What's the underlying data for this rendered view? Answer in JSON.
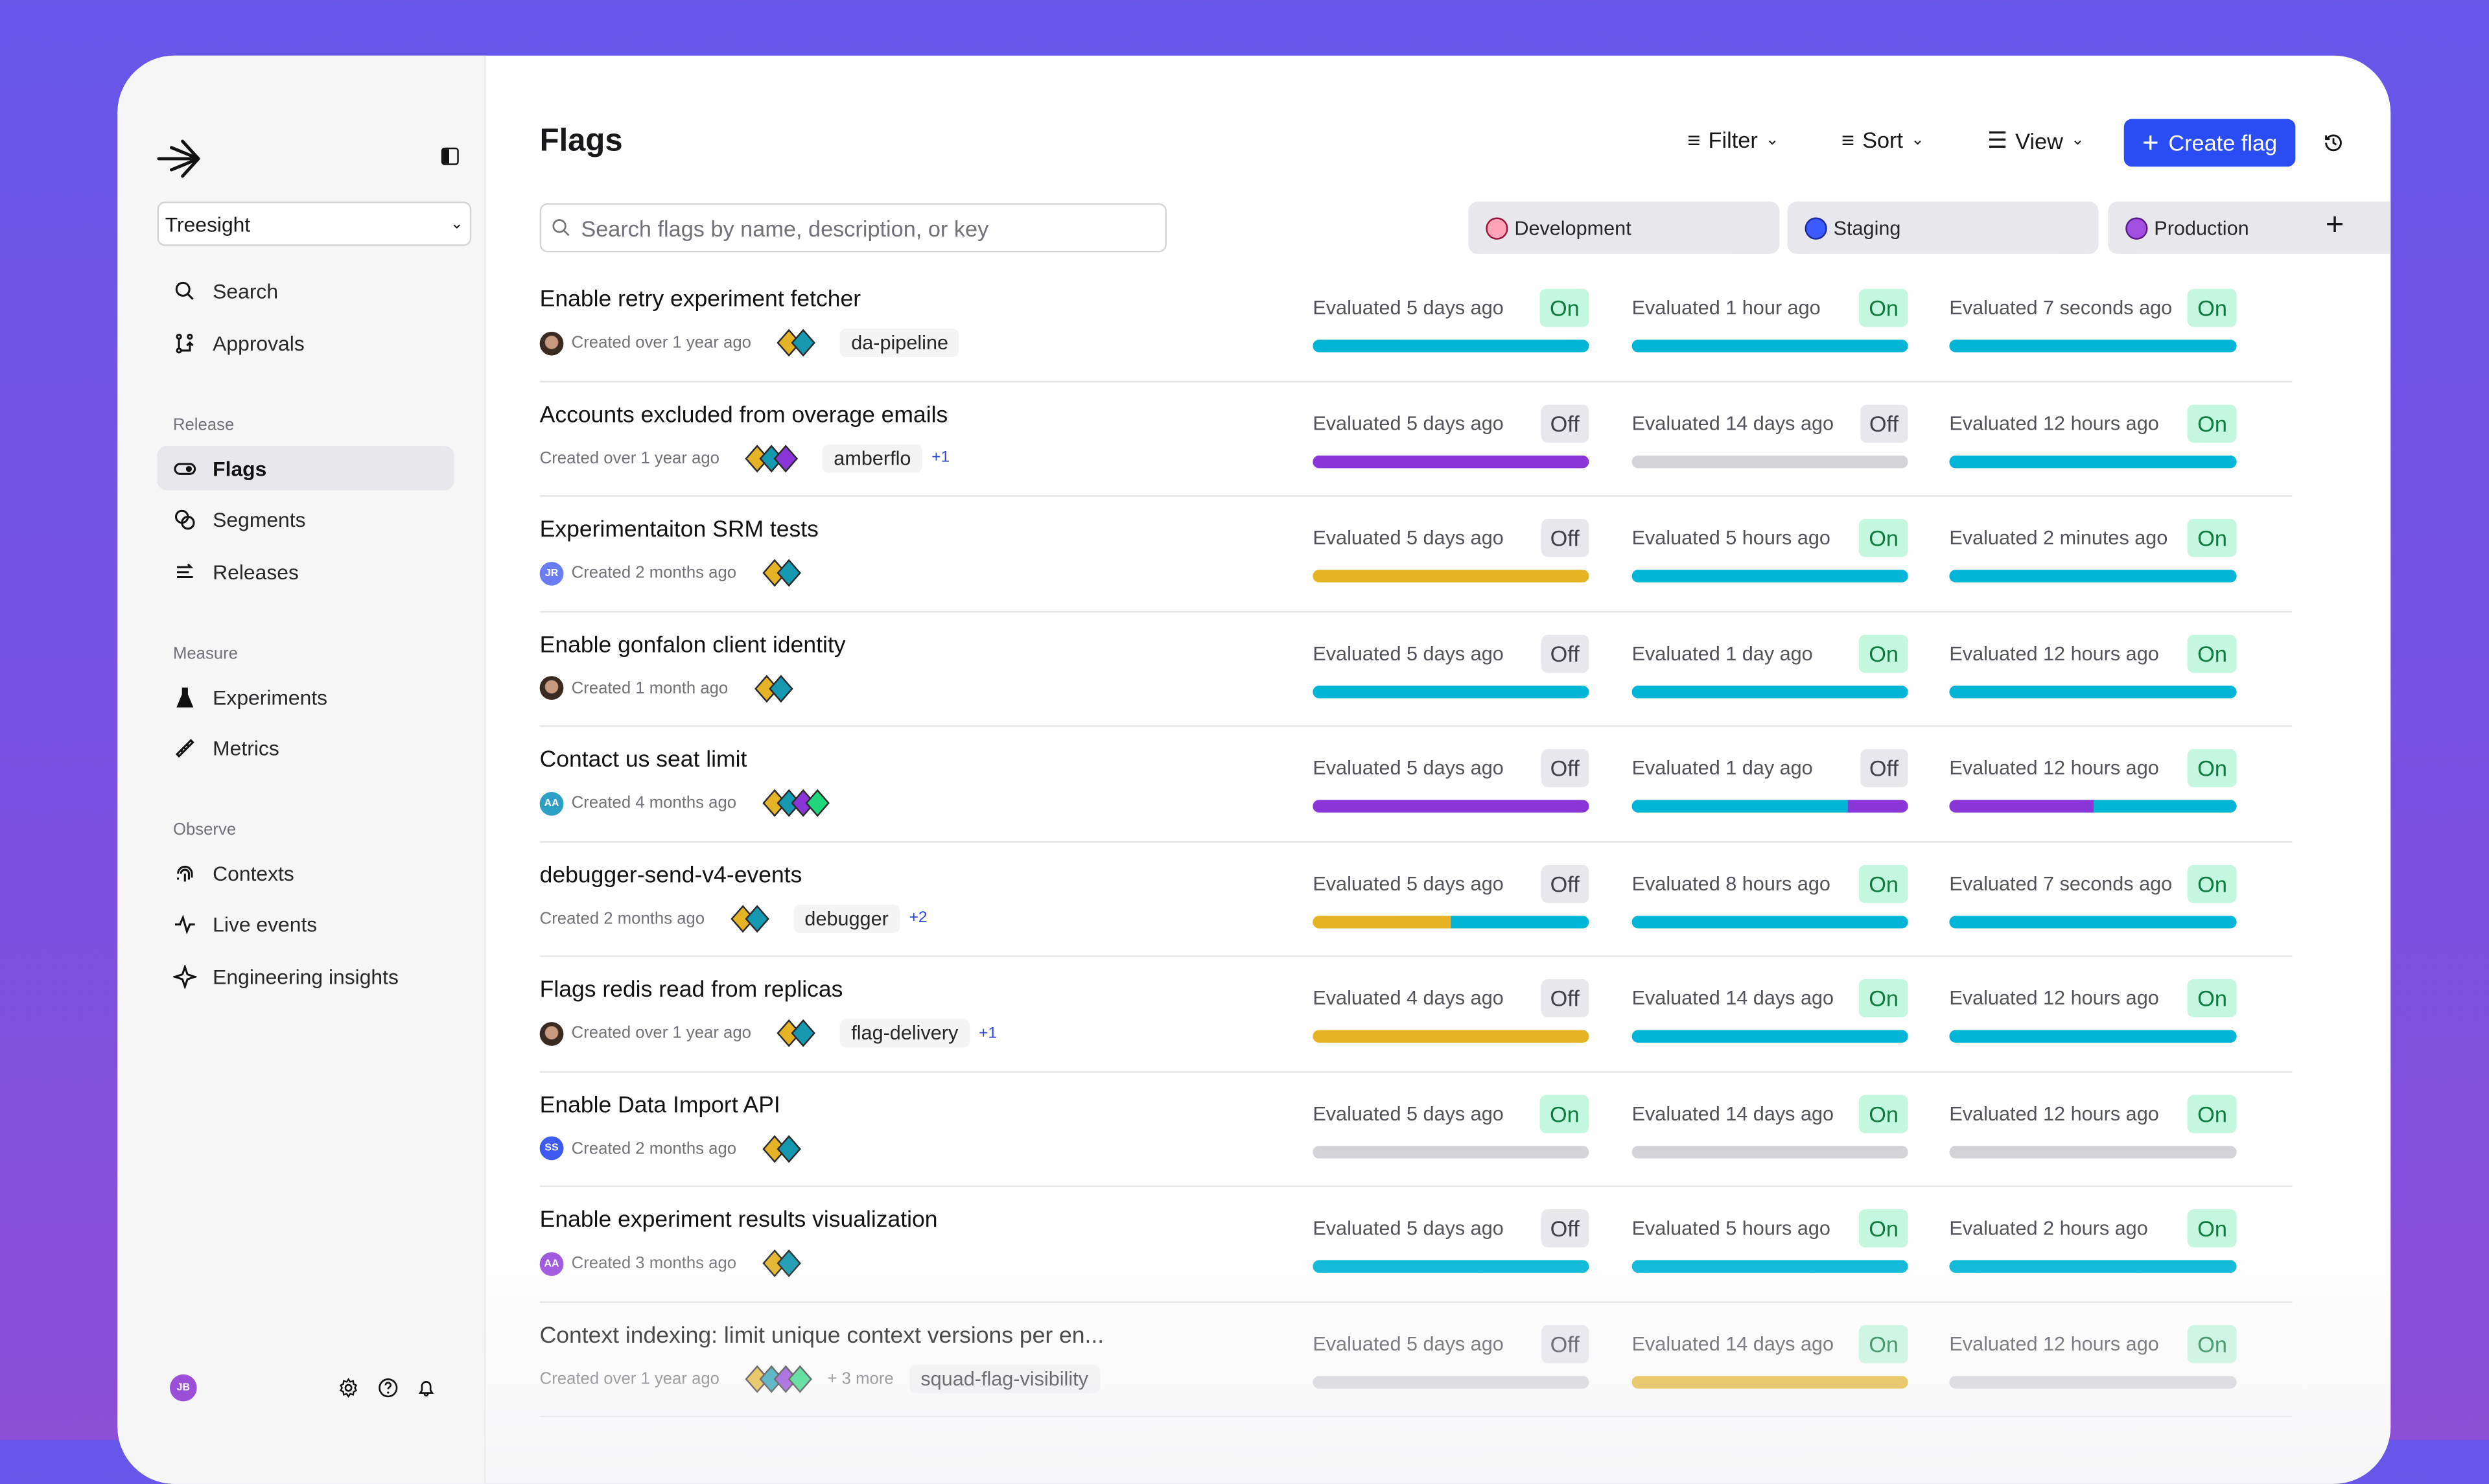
{
  "sidebar": {
    "project": "Treesight",
    "top_items": [
      {
        "label": "Search",
        "icon": "search-icon"
      },
      {
        "label": "Approvals",
        "icon": "approvals-icon"
      }
    ],
    "sections": [
      {
        "label": "Release",
        "items": [
          {
            "label": "Flags",
            "icon": "toggle-icon",
            "active": true
          },
          {
            "label": "Segments",
            "icon": "segments-icon"
          },
          {
            "label": "Releases",
            "icon": "releases-icon"
          }
        ]
      },
      {
        "label": "Measure",
        "items": [
          {
            "label": "Experiments",
            "icon": "flask-icon"
          },
          {
            "label": "Metrics",
            "icon": "ruler-icon"
          }
        ]
      },
      {
        "label": "Observe",
        "items": [
          {
            "label": "Contexts",
            "icon": "fingerprint-icon"
          },
          {
            "label": "Live events",
            "icon": "pulse-icon"
          },
          {
            "label": "Engineering insights",
            "icon": "sparkle-icon"
          }
        ]
      }
    ],
    "user_initials": "JB"
  },
  "header": {
    "title": "Flags",
    "filter": "Filter",
    "sort": "Sort",
    "view": "View",
    "create": "Create flag"
  },
  "search": {
    "placeholder": "Search flags by name, description, or key"
  },
  "environments": [
    {
      "name": "Development",
      "color": "#fda4b8",
      "border": "#9f1239"
    },
    {
      "name": "Staging",
      "color": "#3b5bff",
      "border": "#1e2a9a"
    },
    {
      "name": "Production",
      "color": "#a24ee0",
      "border": "#5b1a8a"
    }
  ],
  "colors": {
    "cyan": "#00b5d6",
    "purple": "#8a35d8",
    "yellow": "#e5b324",
    "gray": "#d4d4d8",
    "teal": "#1599b0",
    "green": "#1fd67a",
    "accent": "#2a4cf5"
  },
  "flags": [
    {
      "name": "Enable retry experiment fetcher",
      "avatar": {
        "type": "photo"
      },
      "created": "Created over 1 year ago",
      "diamonds": [
        "yellow",
        "teal"
      ],
      "tag": "da-pipeline",
      "envs": [
        {
          "eval": "Evaluated 5 days ago",
          "state": "On",
          "bar": [
            [
              "cyan",
              100
            ]
          ]
        },
        {
          "eval": "Evaluated 1 hour ago",
          "state": "On",
          "bar": [
            [
              "cyan",
              100
            ]
          ]
        },
        {
          "eval": "Evaluated 7 seconds ago",
          "state": "On",
          "bar": [
            [
              "cyan",
              100
            ]
          ]
        }
      ]
    },
    {
      "name": "Accounts excluded from overage emails",
      "avatar": {
        "type": "none"
      },
      "created": "Created over 1 year ago",
      "diamonds": [
        "yellow",
        "teal",
        "purple"
      ],
      "tag": "amberflo",
      "extra": "+1",
      "envs": [
        {
          "eval": "Evaluated 5 days ago",
          "state": "Off",
          "bar": [
            [
              "purple",
              100
            ]
          ]
        },
        {
          "eval": "Evaluated 14 days ago",
          "state": "Off",
          "bar": [
            [
              "gray",
              100
            ]
          ]
        },
        {
          "eval": "Evaluated 12 hours ago",
          "state": "On",
          "bar": [
            [
              "cyan",
              100
            ]
          ]
        }
      ]
    },
    {
      "name": "Experimentaiton SRM tests",
      "avatar": {
        "type": "initials",
        "text": "JR",
        "color": "#6b7df5"
      },
      "created": "Created 2 months ago",
      "diamonds": [
        "yellow",
        "teal"
      ],
      "envs": [
        {
          "eval": "Evaluated 5 days ago",
          "state": "Off",
          "bar": [
            [
              "yellow",
              100
            ]
          ]
        },
        {
          "eval": "Evaluated 5 hours ago",
          "state": "On",
          "bar": [
            [
              "cyan",
              100
            ]
          ]
        },
        {
          "eval": "Evaluated 2 minutes ago",
          "state": "On",
          "bar": [
            [
              "cyan",
              100
            ]
          ]
        }
      ]
    },
    {
      "name": "Enable gonfalon client identity",
      "avatar": {
        "type": "photo"
      },
      "created": "Created 1 month ago",
      "diamonds": [
        "yellow",
        "teal"
      ],
      "envs": [
        {
          "eval": "Evaluated 5 days ago",
          "state": "Off",
          "bar": [
            [
              "cyan",
              100
            ]
          ]
        },
        {
          "eval": "Evaluated 1 day ago",
          "state": "On",
          "bar": [
            [
              "cyan",
              100
            ]
          ]
        },
        {
          "eval": "Evaluated 12 hours ago",
          "state": "On",
          "bar": [
            [
              "cyan",
              100
            ]
          ]
        }
      ]
    },
    {
      "name": "Contact us seat limit",
      "avatar": {
        "type": "initials",
        "text": "AA",
        "color": "#2b9fc4"
      },
      "created": "Created 4 months ago",
      "diamonds": [
        "yellow",
        "teal",
        "purple",
        "green"
      ],
      "envs": [
        {
          "eval": "Evaluated 5 days ago",
          "state": "Off",
          "bar": [
            [
              "purple",
              100
            ]
          ]
        },
        {
          "eval": "Evaluated 1 day ago",
          "state": "Off",
          "bar": [
            [
              "cyan",
              78
            ],
            [
              "purple",
              22
            ]
          ]
        },
        {
          "eval": "Evaluated 12 hours ago",
          "state": "On",
          "bar": [
            [
              "purple",
              50
            ],
            [
              "cyan",
              50
            ]
          ]
        }
      ]
    },
    {
      "name": "debugger-send-v4-events",
      "avatar": {
        "type": "none"
      },
      "created": "Created 2 months ago",
      "diamonds": [
        "yellow",
        "teal"
      ],
      "tag": "debugger",
      "extra": "+2",
      "envs": [
        {
          "eval": "Evaluated 5 days ago",
          "state": "Off",
          "bar": [
            [
              "yellow",
              50
            ],
            [
              "cyan",
              50
            ]
          ]
        },
        {
          "eval": "Evaluated 8 hours ago",
          "state": "On",
          "bar": [
            [
              "cyan",
              100
            ]
          ]
        },
        {
          "eval": "Evaluated 7 seconds ago",
          "state": "On",
          "bar": [
            [
              "cyan",
              100
            ]
          ]
        }
      ]
    },
    {
      "name": "Flags redis read from replicas",
      "avatar": {
        "type": "photo"
      },
      "created": "Created over 1 year ago",
      "diamonds": [
        "yellow",
        "teal"
      ],
      "tag": "flag-delivery",
      "extra": "+1",
      "envs": [
        {
          "eval": "Evaluated 4 days ago",
          "state": "Off",
          "bar": [
            [
              "yellow",
              100
            ]
          ]
        },
        {
          "eval": "Evaluated 14 days ago",
          "state": "On",
          "bar": [
            [
              "cyan",
              100
            ]
          ]
        },
        {
          "eval": "Evaluated 12 hours ago",
          "state": "On",
          "bar": [
            [
              "cyan",
              100
            ]
          ]
        }
      ]
    },
    {
      "name": "Enable Data Import API",
      "avatar": {
        "type": "initials",
        "text": "SS",
        "color": "#3d5af1"
      },
      "created": "Created 2 months ago",
      "diamonds": [
        "yellow",
        "teal"
      ],
      "envs": [
        {
          "eval": "Evaluated 5 days ago",
          "state": "On",
          "bar": [
            [
              "gray",
              100
            ]
          ]
        },
        {
          "eval": "Evaluated 14 days ago",
          "state": "On",
          "bar": [
            [
              "gray",
              100
            ]
          ]
        },
        {
          "eval": "Evaluated 12 hours ago",
          "state": "On",
          "bar": [
            [
              "gray",
              100
            ]
          ]
        }
      ]
    },
    {
      "name": "Enable experiment results visualization",
      "avatar": {
        "type": "initials",
        "text": "AA",
        "color": "#9b4fdc"
      },
      "created": "Created 3 months ago",
      "diamonds": [
        "yellow",
        "teal"
      ],
      "envs": [
        {
          "eval": "Evaluated 5 days ago",
          "state": "Off",
          "bar": [
            [
              "cyan",
              100
            ]
          ]
        },
        {
          "eval": "Evaluated 5 hours ago",
          "state": "On",
          "bar": [
            [
              "cyan",
              100
            ]
          ]
        },
        {
          "eval": "Evaluated 2 hours ago",
          "state": "On",
          "bar": [
            [
              "cyan",
              100
            ]
          ]
        }
      ]
    },
    {
      "name": "Context indexing: limit unique context versions per en...",
      "avatar": {
        "type": "none"
      },
      "created": "Created over 1 year ago",
      "diamonds": [
        "yellow",
        "teal",
        "purple",
        "green"
      ],
      "more": "+ 3 more",
      "tag": "squad-flag-visibility",
      "envs": [
        {
          "eval": "Evaluated 5 days ago",
          "state": "Off",
          "bar": [
            [
              "gray",
              100
            ]
          ]
        },
        {
          "eval": "Evaluated 14 days ago",
          "state": "On",
          "bar": [
            [
              "yellow",
              100
            ]
          ]
        },
        {
          "eval": "Evaluated 12 hours ago",
          "state": "On",
          "bar": [
            [
              "gray",
              100
            ]
          ]
        }
      ]
    }
  ]
}
